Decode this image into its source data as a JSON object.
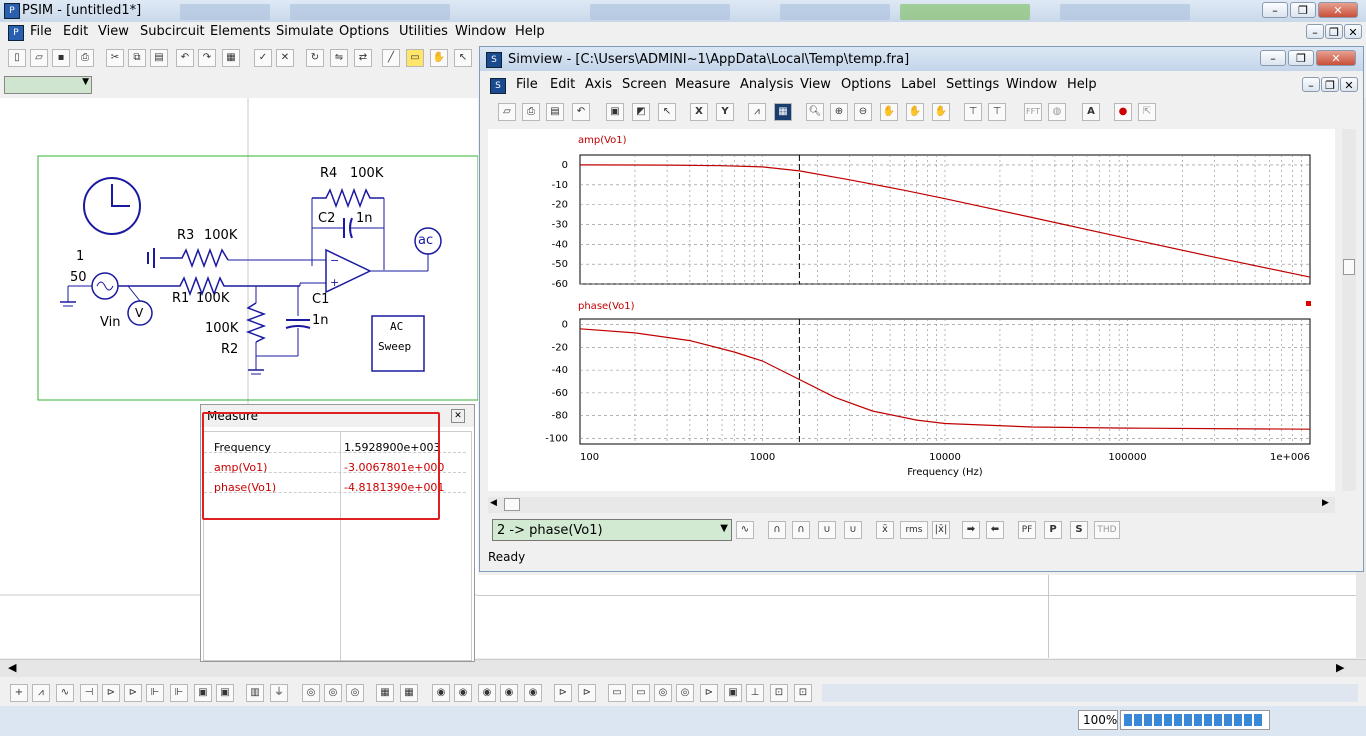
{
  "psim": {
    "title": "PSIM - [untitled1*]",
    "menu": [
      "File",
      "Edit",
      "View",
      "Subcircuit",
      "Elements",
      "Simulate",
      "Options",
      "Utilities",
      "Window",
      "Help"
    ]
  },
  "simview": {
    "title": "Simview - [C:\\Users\\ADMINI~1\\AppData\\Local\\Temp\\temp.fra]",
    "menu": [
      "File",
      "Edit",
      "Axis",
      "Screen",
      "Measure",
      "Analysis",
      "View",
      "Options",
      "Label",
      "Settings",
      "Window",
      "Help"
    ],
    "status": "Ready",
    "select_value": "2 -> phase(Vo1)",
    "tool_labels": {
      "x": "X",
      "y": "Y",
      "rms": "rms",
      "pf": "PF",
      "p": "P",
      "s": "S",
      "thd": "THD",
      "a": "A",
      "fft": "FFT"
    }
  },
  "circuit": {
    "labels": {
      "r4": "R4",
      "r4v": "100K",
      "c2": "C2",
      "c2v": "1n",
      "r3": "R3",
      "r3v": "100K",
      "r1": "R1",
      "r1v": "100K",
      "c1": "C1",
      "c1v": "1n",
      "r2v": "100K",
      "r2": "R2",
      "one": "1",
      "fifty": "50",
      "vin": "Vin",
      "v": "V",
      "ac": "ac",
      "acsweep1": "AC",
      "acsweep2": "Sweep"
    }
  },
  "measure": {
    "title": "Measure",
    "rows": [
      {
        "name": "Frequency",
        "value": "1.5928900e+003",
        "color": "#000000"
      },
      {
        "name": "amp(Vo1)",
        "value": "-3.0067801e+000",
        "color": "#cc0000"
      },
      {
        "name": "phase(Vo1)",
        "value": "-4.8181390e+001",
        "color": "#cc0000"
      }
    ]
  },
  "zoom": "100%",
  "chart_data": [
    {
      "type": "line",
      "title": "amp(Vo1)",
      "xscale": "log",
      "xlim": [
        100,
        1000000
      ],
      "ylim": [
        -60,
        5
      ],
      "yticks": [
        "0",
        "-10",
        "-20",
        "-30",
        "-40",
        "-50",
        "-60"
      ],
      "series": [
        {
          "name": "amp(Vo1)",
          "color": "#c00000",
          "x": [
            100,
            300,
            600,
            1000,
            1592.89,
            3000,
            6000,
            10000,
            30000,
            100000,
            300000,
            1000000
          ],
          "y": [
            0,
            -0.1,
            -0.4,
            -1,
            -3.0,
            -7.5,
            -12.8,
            -17,
            -26.5,
            -37,
            -46.5,
            -56.5
          ]
        }
      ]
    },
    {
      "type": "line",
      "title": "phase(Vo1)",
      "xscale": "log",
      "xlim": [
        100,
        1000000
      ],
      "ylim": [
        -105,
        5
      ],
      "yticks": [
        "0",
        "-20",
        "-40",
        "-60",
        "-80",
        "-100"
      ],
      "xticks": [
        "100",
        "1000",
        "10000",
        "100000",
        "1e+006"
      ],
      "xlabel": "Frequency (Hz)",
      "series": [
        {
          "name": "phase(Vo1)",
          "color": "#c00000",
          "x": [
            100,
            200,
            400,
            700,
            1000,
            1592.89,
            2500,
            4000,
            7000,
            10000,
            30000,
            100000,
            1000000
          ],
          "y": [
            -3.6,
            -7.2,
            -14,
            -24,
            -32,
            -48.2,
            -64,
            -76,
            -84,
            -87,
            -90,
            -91,
            -92
          ]
        }
      ]
    }
  ]
}
